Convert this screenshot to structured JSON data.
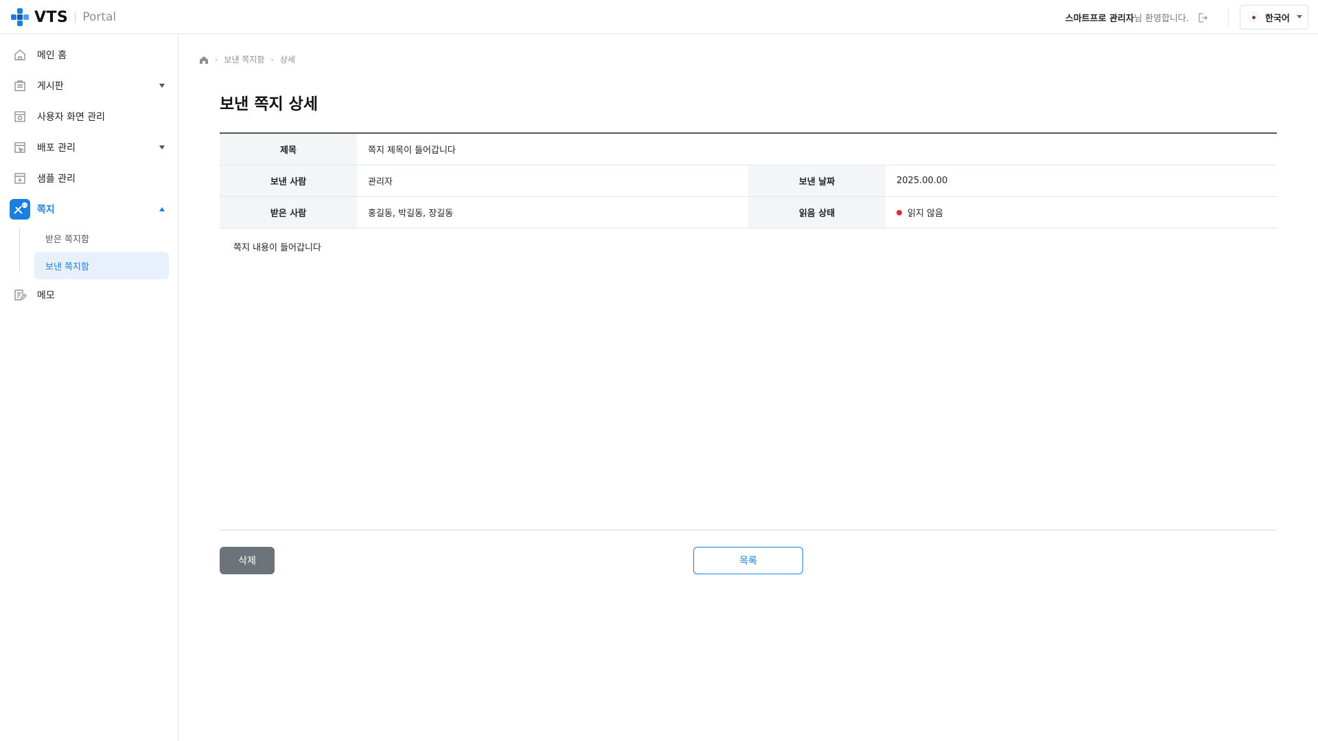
{
  "header": {
    "logo_text": "VTS",
    "logo_sub": "Portal",
    "welcome_user": "스마트프로 관리자",
    "welcome_suffix": "님 환영합니다.",
    "logout_icon": "logout-icon",
    "language": "한국어"
  },
  "sidebar": {
    "items": [
      {
        "label": "메인 홈",
        "icon": "home-icon"
      },
      {
        "label": "게시판",
        "icon": "board-icon"
      },
      {
        "label": "사용자 화면 관리",
        "icon": "screen-settings-icon"
      },
      {
        "label": "배포 관리",
        "icon": "deploy-icon"
      },
      {
        "label": "샘플 관리",
        "icon": "sample-icon"
      },
      {
        "label": "쪽지",
        "icon": "message-icon"
      },
      {
        "label": "메모",
        "icon": "memo-icon"
      }
    ],
    "sub_items": [
      {
        "label": "받은 쪽지함"
      },
      {
        "label": "보낸 쪽지함"
      }
    ]
  },
  "breadcrumb": {
    "home_icon": "home-icon",
    "items": [
      "보낸 쪽지함",
      "상세"
    ]
  },
  "page": {
    "title": "보낸 쪽지 상세"
  },
  "detail": {
    "subject_label": "제목",
    "subject_value": "쪽지 제목이 들어갑니다",
    "sender_label": "보낸 사람",
    "sender_value": "관리자",
    "sent_date_label": "보낸 날짜",
    "sent_date_value": "2025.00.00",
    "recipients_label": "받은 사람",
    "recipients_value": "홍길동, 박길동, 장길동",
    "read_status_label": "읽음 상태",
    "read_status_value": "읽지 않음",
    "content": "쪽지 내용이 들어갑니다"
  },
  "buttons": {
    "delete": "삭제",
    "list": "목록"
  },
  "colors": {
    "accent": "#1a7fe0",
    "unread_dot": "#e5283b",
    "delete_button": "#6d737b"
  }
}
